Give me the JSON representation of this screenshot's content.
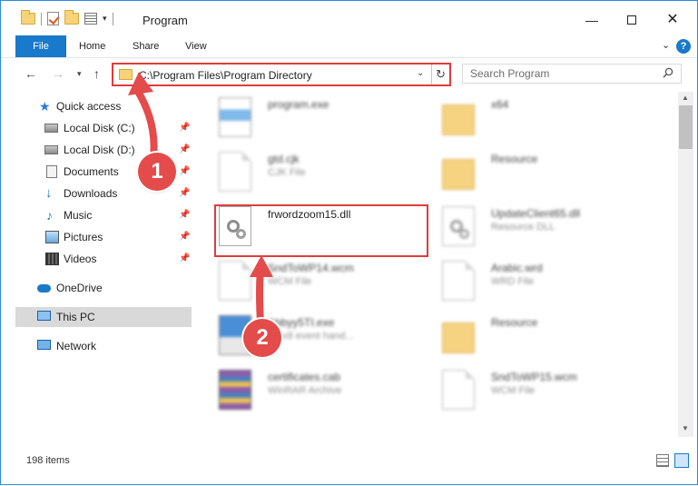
{
  "window": {
    "title": "Program",
    "accent": "#1979ca",
    "highlight_color": "#e03c3c"
  },
  "ribbon": {
    "file": "File",
    "home": "Home",
    "share": "Share",
    "view": "View",
    "help": "?"
  },
  "address": {
    "path": "C:\\Program Files\\Program Directory"
  },
  "search": {
    "placeholder": "Search Program"
  },
  "sidebar": {
    "items": [
      {
        "label": "Quick access",
        "icon": "star-icon"
      },
      {
        "label": "Local Disk (C:)",
        "icon": "drive-icon"
      },
      {
        "label": "Local Disk (D:)",
        "icon": "drive-icon"
      },
      {
        "label": "Documents",
        "icon": "documents-icon"
      },
      {
        "label": "Downloads",
        "icon": "download-icon"
      },
      {
        "label": "Music",
        "icon": "music-icon"
      },
      {
        "label": "Pictures",
        "icon": "pictures-icon"
      },
      {
        "label": "Videos",
        "icon": "videos-icon"
      },
      {
        "label": "OneDrive",
        "icon": "cloud-icon"
      },
      {
        "label": "This PC",
        "icon": "computer-icon"
      },
      {
        "label": "Network",
        "icon": "network-icon"
      }
    ],
    "selected": "This PC"
  },
  "files": [
    {
      "name": "program.exe",
      "desc": "",
      "icon": "exe-icon"
    },
    {
      "name": "x64",
      "desc": "",
      "icon": "folder-icon"
    },
    {
      "name": "gtd.cjk",
      "desc": "CJK File",
      "icon": "file-icon"
    },
    {
      "name": "Resource",
      "desc": "",
      "icon": "folder-icon"
    },
    {
      "name": "frwordzoom15.dll",
      "desc": "",
      "icon": "dll-icon"
    },
    {
      "name": "UpdateClient65.dll",
      "desc": "Resource DLL",
      "icon": "dll-icon"
    },
    {
      "name": "SndToWP14.wcm",
      "desc": "WCM File",
      "icon": "file-icon"
    },
    {
      "name": "Arabic.wrd",
      "desc": "WRD File",
      "icon": "file-icon"
    },
    {
      "name": "Abbyy5TI.exe",
      "desc": "AT x8 event hand...",
      "icon": "app-icon"
    },
    {
      "name": "Resource",
      "desc": "",
      "icon": "folder-icon"
    },
    {
      "name": "certificates.cab",
      "desc": "WinRAR Archive",
      "icon": "archive-icon"
    },
    {
      "name": "SndToWP15.wcm",
      "desc": "WCM File",
      "icon": "file-icon"
    }
  ],
  "status": {
    "items": "198 items"
  },
  "callouts": {
    "one": "1",
    "two": "2"
  }
}
